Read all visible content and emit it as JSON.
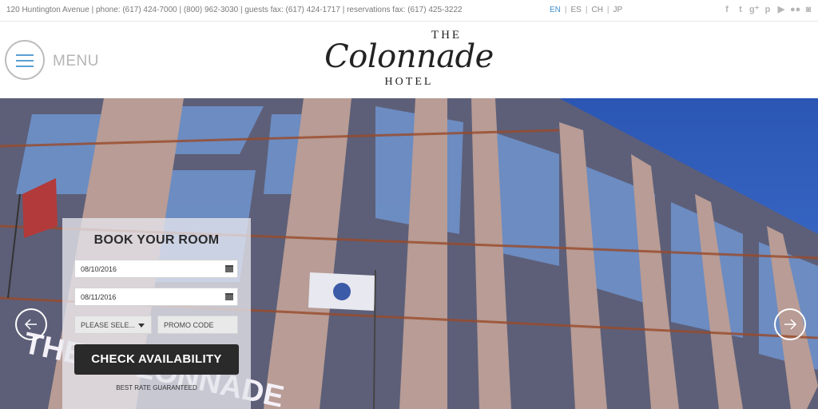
{
  "topbar": {
    "contact": "120 Huntington Avenue | phone: (617) 424-7000 | (800) 962-3030 | guests fax: (617) 424-1717 | reservations fax: (617) 425-3222",
    "languages": [
      "EN",
      "ES",
      "CH",
      "JP"
    ],
    "active_language": "EN",
    "social_icons": [
      "facebook-icon",
      "twitter-icon",
      "google-plus-icon",
      "pinterest-icon",
      "youtube-icon",
      "flickr-icon",
      "instagram-icon"
    ]
  },
  "header": {
    "menu_label": "MENU",
    "logo": {
      "the": "THE",
      "name": "Colonnade",
      "hotel": "HOTEL"
    }
  },
  "booking": {
    "title": "BOOK YOUR ROOM",
    "checkin": "08/10/2016",
    "checkout": "08/11/2016",
    "select_label": "PLEASE SELE...",
    "promo_placeholder": "PROMO CODE",
    "check_button": "CHECK AVAILABILITY",
    "guarantee": "BEST RATE GUARANTEED"
  },
  "hero": {
    "sign_text": "THE COLONNADE"
  },
  "colors": {
    "accent": "#3a8fd0",
    "button": "#2a2a2a",
    "sky": "#2f5fa6"
  }
}
